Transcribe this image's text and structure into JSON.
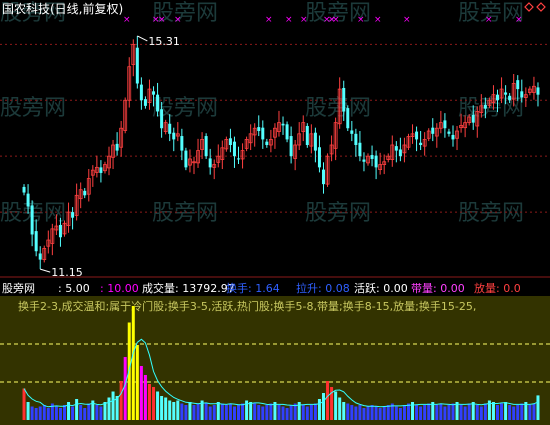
{
  "colors": {
    "background": "#000000",
    "up": "#ff4040",
    "down": "#54ffff",
    "grid": "#8c1a1a",
    "marker": "#ff00ff",
    "lower_panel_bg": "#333300",
    "ref_line": "#ffff66",
    "info_yellow": "#ffff00",
    "watermark": "#1c3a3a"
  },
  "header": {
    "title": "国农科技(日线,前复权)",
    "diamond_icon": "diamond-icon"
  },
  "price_panel": {
    "high_label": "15.31",
    "low_label": "11.15",
    "markers": [
      123,
      152,
      158,
      174,
      265,
      285,
      300,
      323,
      328,
      332,
      357,
      374,
      403,
      485,
      515
    ]
  },
  "indicator_bar": {
    "items": [
      {
        "key": "name",
        "text": "股旁网",
        "color": "#ffffff"
      },
      {
        "key": "p1",
        "text": ": 5.00",
        "color": "#ffffff"
      },
      {
        "key": "p2",
        "text": ": 10.00",
        "color": "#ff00ff"
      },
      {
        "key": "vol",
        "text": "成交量: 13792.97",
        "color": "#ffffff"
      },
      {
        "key": "turn",
        "text": "换手: 1.64",
        "color": "#3060ff"
      },
      {
        "key": "pull",
        "text": "拉升: 0.08",
        "color": "#3060ff"
      },
      {
        "key": "active",
        "text": "活跃: 0.00",
        "color": "#ffffff"
      },
      {
        "key": "belt",
        "text": "带量: 0.00",
        "color": "#ff40ff"
      },
      {
        "key": "heavy",
        "text": "放量: 0.0",
        "color": "#ff4040"
      }
    ]
  },
  "lower_panel": {
    "description_text": "换手2-3,成交温和;属于冷门股;换手3-5,活跃,热门股;换手5-8,带量;换手8-15,放量;换手15-25,"
  },
  "watermark": {
    "text": "股旁网"
  },
  "chart_data": [
    {
      "type": "candlestick",
      "title": "国农科技(日线,前复权)",
      "annotations": [
        {
          "label": "15.31",
          "kind": "period-high"
        },
        {
          "label": "11.15",
          "kind": "period-low"
        }
      ],
      "ylim": [
        11.0,
        15.4
      ],
      "series": [
        {
          "name": "close",
          "values": [
            12.35,
            12.1,
            11.6,
            11.3,
            11.15,
            11.35,
            11.5,
            11.7,
            11.75,
            11.55,
            11.8,
            12.0,
            11.9,
            12.3,
            12.4,
            12.3,
            12.6,
            12.75,
            12.8,
            12.7,
            12.85,
            13.0,
            13.2,
            13.1,
            13.5,
            14.0,
            14.6,
            15.0,
            14.3,
            14.0,
            13.9,
            14.2,
            14.1,
            13.8,
            13.5,
            13.6,
            13.4,
            13.3,
            13.4,
            13.1,
            12.8,
            12.95,
            12.9,
            13.1,
            13.3,
            13.0,
            12.8,
            12.85,
            13.0,
            13.15,
            13.3,
            13.2,
            13.0,
            12.95,
            13.1,
            13.3,
            13.4,
            13.5,
            13.45,
            13.3,
            13.2,
            13.3,
            13.5,
            13.6,
            13.55,
            13.3,
            13.0,
            13.2,
            13.4,
            13.6,
            13.2,
            13.4,
            13.1,
            12.8,
            12.5,
            13.0,
            13.2,
            13.6,
            14.2,
            13.8,
            13.5,
            13.4,
            13.2,
            13.0,
            12.9,
            13.0,
            12.95,
            12.8,
            12.85,
            12.9,
            13.0,
            13.2,
            13.1,
            13.0,
            13.2,
            13.35,
            13.4,
            13.3,
            13.2,
            13.3,
            13.45,
            13.4,
            13.5,
            13.6,
            13.5,
            13.4,
            13.3,
            13.45,
            13.55,
            13.6,
            13.7,
            13.6,
            13.8,
            13.9,
            13.85,
            14.0,
            14.1,
            14.0,
            14.2,
            14.1,
            14.0,
            14.3,
            14.2,
            14.05,
            14.1,
            14.2,
            14.25,
            14.1
          ]
        }
      ]
    },
    {
      "type": "bar",
      "title": "",
      "series": [
        {
          "name": "换手",
          "values": [
            2.1,
            1.2,
            0.9,
            0.8,
            0.9,
            1.0,
            0.8,
            1.1,
            0.9,
            0.8,
            1.0,
            1.2,
            0.9,
            1.4,
            1.0,
            0.8,
            1.1,
            1.3,
            1.0,
            0.9,
            1.2,
            1.5,
            1.9,
            1.6,
            2.6,
            4.2,
            6.5,
            7.6,
            5.0,
            3.6,
            3.0,
            2.4,
            2.2,
            1.9,
            1.6,
            1.5,
            1.3,
            1.2,
            1.3,
            1.1,
            1.0,
            1.2,
            1.0,
            1.1,
            1.3,
            1.1,
            0.9,
            1.0,
            1.2,
            1.1,
            1.0,
            1.1,
            0.9,
            1.0,
            1.1,
            1.3,
            1.2,
            1.1,
            1.0,
            0.9,
            1.0,
            1.1,
            1.2,
            1.0,
            0.9,
            0.8,
            1.0,
            1.1,
            1.2,
            1.0,
            0.9,
            1.0,
            1.1,
            1.4,
            1.8,
            2.6,
            2.2,
            1.9,
            1.5,
            1.2,
            1.1,
            1.0,
            0.9,
            1.0,
            0.8,
            0.9,
            1.0,
            0.9,
            0.8,
            0.9,
            1.0,
            1.1,
            0.9,
            0.8,
            1.0,
            1.1,
            1.2,
            1.0,
            0.9,
            1.0,
            1.1,
            1.2,
            1.0,
            1.1,
            0.9,
            1.0,
            1.1,
            1.2,
            1.0,
            0.9,
            1.1,
            1.2,
            1.0,
            0.9,
            1.1,
            1.3,
            1.2,
            1.0,
            1.1,
            1.2,
            1.0,
            0.9,
            1.0,
            1.1,
            1.2,
            1.0,
            1.1,
            1.64
          ]
        }
      ]
    }
  ]
}
